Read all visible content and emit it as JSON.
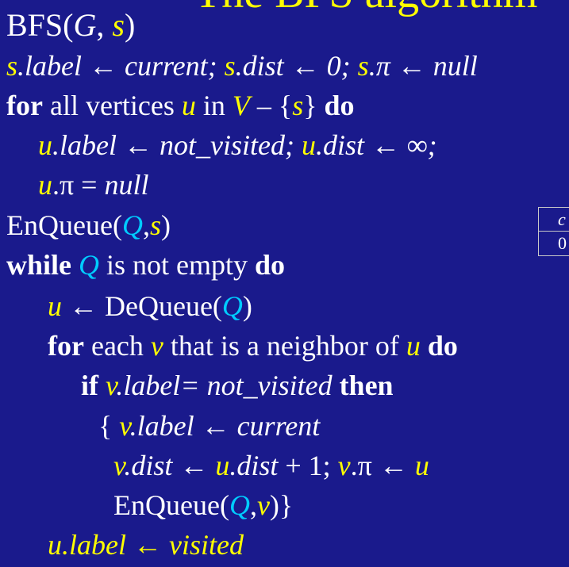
{
  "slide": {
    "title_fragment": "The BFS algorithm"
  },
  "code": {
    "l1": {
      "name": "BFS(",
      "G": "G",
      "comma": ", ",
      "s": "s",
      "close": ")"
    },
    "l2": {
      "s1": "s",
      "t1": ".label ← current; ",
      "s2": "s",
      "t2": ".dist ← 0; ",
      "s3": "s",
      "t3": ".π ← null"
    },
    "l3": {
      "for": "for",
      "t1": " all vertices ",
      "u": "u",
      "t2": " in ",
      "V": "V",
      "t3": " – {",
      "s": "s",
      "t4": "} ",
      "do": "do"
    },
    "l4": {
      "u1": "u",
      "t1": ".label ← not_visited; ",
      "u2": "u",
      "t2": ".dist ← ∞;"
    },
    "l5": {
      "u": "u",
      "t1": ".π = ",
      "null": "null"
    },
    "l6": {
      "t1": "EnQueue(",
      "Q": "Q",
      "comma": ",",
      "s": "s",
      "close": ")"
    },
    "l7": {
      "while": "while",
      "sp": " ",
      "Q": "Q",
      "t1": " is not empty ",
      "do": "do"
    },
    "l8": {
      "u": "u",
      "t1": " ← DeQueue(",
      "Q": "Q",
      "close": ")"
    },
    "l9": {
      "for": "for",
      "t1": " each ",
      "v": "v",
      "t2": " that is a neighbor of ",
      "u": "u",
      "sp": " ",
      "do": "do"
    },
    "l10": {
      "if": "if",
      "sp": " ",
      "v": "v",
      "t1": ".label= not_visited ",
      "then": "then"
    },
    "l11": {
      "brace": "{ ",
      "v": "v",
      "t1": ".label ← current"
    },
    "l12": {
      "v1": "v",
      "t1": ".dist ← ",
      "u": "u",
      "t2": ".dist",
      "t3": " + 1; ",
      "v2": "v",
      "t4": ".π ← ",
      "u2": "u"
    },
    "l13": {
      "t1": "EnQueue(",
      "Q": "Q",
      "comma": ",",
      "v": "v",
      "close": ")}"
    },
    "l14": {
      "u": "u",
      "t1": ".label ← visited"
    }
  },
  "table_fragment": {
    "header": "c",
    "value": "0"
  }
}
